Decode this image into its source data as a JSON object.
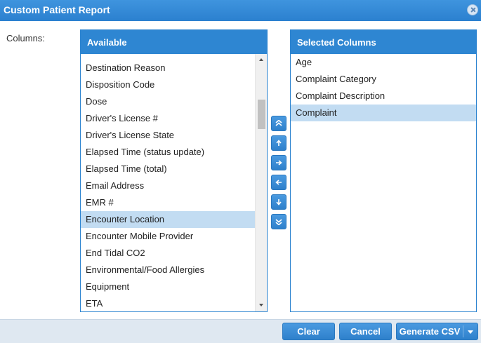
{
  "dialog": {
    "title": "Custom Patient Report"
  },
  "columns_label": "Columns:",
  "available": {
    "header": "Available",
    "items": [
      "Destination Reason",
      "Disposition Code",
      "Dose",
      "Driver's License #",
      "Driver's License State",
      "Elapsed Time (status update)",
      "Elapsed Time (total)",
      "Email Address",
      "EMR #",
      "Encounter Location",
      "Encounter Mobile Provider",
      "End Tidal CO2",
      "Environmental/Food Allergies",
      "Equipment",
      "ETA"
    ],
    "selected_item": "Encounter Location"
  },
  "selected": {
    "header": "Selected Columns",
    "items": [
      "Age",
      "Complaint Category",
      "Complaint Description",
      "Complaint"
    ],
    "selected_item": "Complaint"
  },
  "move_buttons": [
    "move-to-top-icon",
    "move-up-icon",
    "add-right-icon",
    "remove-left-icon",
    "move-down-icon",
    "move-to-bottom-icon"
  ],
  "footer": {
    "clear_label": "Clear",
    "cancel_label": "Cancel",
    "generate_label": "Generate CSV"
  },
  "colors": {
    "accent": "#2e86d2",
    "selection": "#c2dcf2",
    "footer_bg": "#dfe8f1"
  }
}
